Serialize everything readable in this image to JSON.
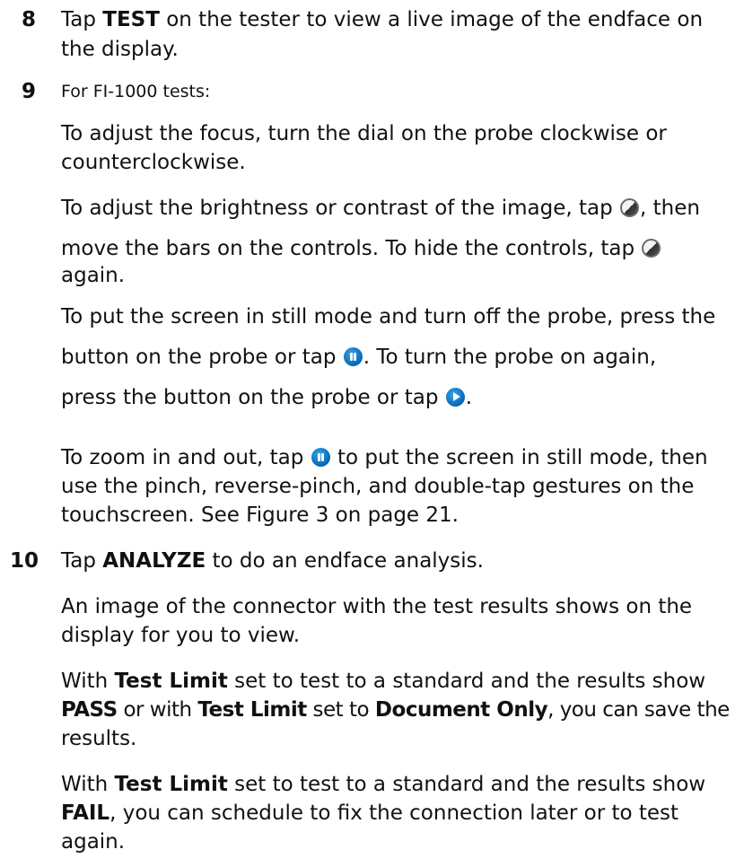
{
  "steps": {
    "s8": {
      "number": "8",
      "l1a": "Tap ",
      "l1b": "TEST",
      "l1c": " on the tester to view a live image of the endface on",
      "l2": "the display."
    },
    "s9": {
      "number": "9",
      "intro": "For FI-1000 tests:",
      "p1l1": "To adjust the focus, turn the dial on the probe clockwise or",
      "p1l2": "counterclockwise.",
      "p2l1a": "To adjust the brightness or contrast of the image, tap ",
      "p2l1b": ", then",
      "p2l2a": "move the bars on the controls. To hide the controls, tap ",
      "p2l3": "again.",
      "p3l1": "To put the screen in still mode and turn off the probe, press the",
      "p3l2a": "button on the probe or tap ",
      "p3l2b": ". To turn the probe on again,",
      "p3l3a": "press the button on the probe or tap ",
      "p3l3b": ".",
      "p4l1a": "To zoom in and out, tap ",
      "p4l1b": " to put the screen in still mode, then",
      "p4l2": "use the pinch, reverse-pinch, and double-tap gestures on the",
      "p4l3": "touchscreen. See Figure 3 on page 21."
    },
    "s10": {
      "number": "10",
      "l1a": "Tap ",
      "l1b": "ANALYZE",
      "l1c": " to do an endface analysis.",
      "p1l1": "An image of the connector with the test results shows on the",
      "p1l2": "display for you to view.",
      "p2l1a": "With ",
      "p2l1b": "Test Limit",
      "p2l1c": " set to test to a standard and the results show",
      "p2l2a": "PASS",
      "p2l2b": " or with ",
      "p2l2c": "Test Limit",
      "p2l2d": " set to ",
      "p2l2e": "Document Only",
      "p2l2f": ", you can save the",
      "p2l3": "results.",
      "p3l1a": "With ",
      "p3l1b": "Test Limit",
      "p3l1c": " set to test to a standard and the results show",
      "p3l2a": "FAIL",
      "p3l2b": ", you can schedule to fix the connection later or to test",
      "p3l3": "again."
    }
  },
  "icons": {
    "contrast": "contrast-icon",
    "pause": "pause-icon",
    "play": "play-icon",
    "accent_color": "#0a6fbf"
  }
}
